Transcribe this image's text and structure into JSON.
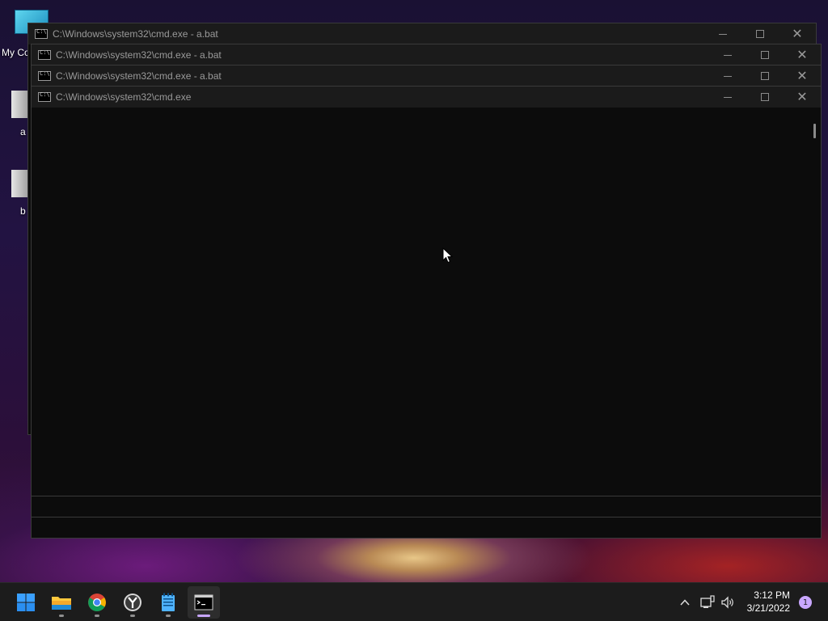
{
  "desktop": {
    "icons": [
      {
        "label": "My Co",
        "name": "my-computer"
      },
      {
        "label": "a",
        "name": "a-bat-file"
      },
      {
        "label": "b",
        "name": "b-file"
      }
    ]
  },
  "windows": [
    {
      "title": "C:\\Windows\\system32\\cmd.exe - a.bat"
    },
    {
      "title": "C:\\Windows\\system32\\cmd.exe - a.bat"
    },
    {
      "title": "C:\\Windows\\system32\\cmd.exe - a.bat"
    },
    {
      "title": "C:\\Windows\\system32\\cmd.exe"
    }
  ],
  "taskbar": {
    "apps": [
      {
        "name": "start-icon",
        "state": "none"
      },
      {
        "name": "file-explorer-icon",
        "state": "open"
      },
      {
        "name": "chrome-icon",
        "state": "open"
      },
      {
        "name": "yandex-browser-icon",
        "state": "open"
      },
      {
        "name": "notepad-icon",
        "state": "open"
      },
      {
        "name": "command-prompt-icon",
        "state": "active"
      }
    ],
    "tray": {
      "time": "3:12 PM",
      "date": "3/21/2022",
      "notification_count": "1"
    }
  },
  "colors": {
    "taskbar_bg": "#1c1c1c",
    "console_bg": "#0c0c0c",
    "accent": "#c7a6ff"
  }
}
